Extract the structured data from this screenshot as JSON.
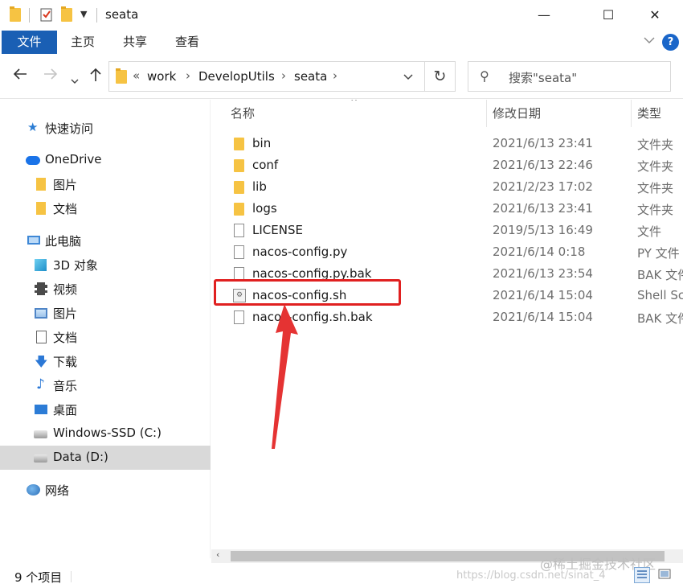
{
  "window": {
    "title": "seata",
    "minimize": "—",
    "maximize": "☐",
    "close": "✕"
  },
  "ribbon": {
    "file_tab": "文件",
    "tabs": [
      "主页",
      "共享",
      "查看"
    ],
    "help": "?"
  },
  "address": {
    "prefix": "«",
    "crumbs": [
      "work",
      "DevelopUtils",
      "seata"
    ],
    "search_placeholder": "搜索\"seata\""
  },
  "sidebar": {
    "items": [
      {
        "label": "快速访问",
        "icon": "star-icon"
      },
      {
        "label": "OneDrive",
        "icon": "cloud-icon"
      },
      {
        "label": "图片",
        "icon": "folder-icon"
      },
      {
        "label": "文档",
        "icon": "folder-icon"
      },
      {
        "label": "此电脑",
        "icon": "pc-icon"
      },
      {
        "label": "3D 对象",
        "icon": "cube-icon"
      },
      {
        "label": "视频",
        "icon": "film-icon"
      },
      {
        "label": "图片",
        "icon": "picture-icon"
      },
      {
        "label": "文档",
        "icon": "document-icon"
      },
      {
        "label": "下载",
        "icon": "download-icon"
      },
      {
        "label": "音乐",
        "icon": "music-icon"
      },
      {
        "label": "桌面",
        "icon": "desktop-icon"
      },
      {
        "label": "Windows-SSD (C:)",
        "icon": "drive-icon"
      },
      {
        "label": "Data (D:)",
        "icon": "drive-icon"
      },
      {
        "label": "网络",
        "icon": "network-icon"
      }
    ]
  },
  "columns": {
    "name": "名称",
    "date": "修改日期",
    "type": "类型"
  },
  "files": [
    {
      "name": "bin",
      "date": "2021/6/13 23:41",
      "type": "文件夹",
      "kind": "folder"
    },
    {
      "name": "conf",
      "date": "2021/6/13 22:46",
      "type": "文件夹",
      "kind": "folder"
    },
    {
      "name": "lib",
      "date": "2021/2/23 17:02",
      "type": "文件夹",
      "kind": "folder"
    },
    {
      "name": "logs",
      "date": "2021/6/13 23:41",
      "type": "文件夹",
      "kind": "folder"
    },
    {
      "name": "LICENSE",
      "date": "2019/5/13 16:49",
      "type": "文件",
      "kind": "file"
    },
    {
      "name": "nacos-config.py",
      "date": "2021/6/14 0:18",
      "type": "PY 文件",
      "kind": "file"
    },
    {
      "name": "nacos-config.py.bak",
      "date": "2021/6/13 23:54",
      "type": "BAK 文件",
      "kind": "file"
    },
    {
      "name": "nacos-config.sh",
      "date": "2021/6/14 15:04",
      "type": "Shell Script",
      "kind": "shell"
    },
    {
      "name": "nacos-config.sh.bak",
      "date": "2021/6/14 15:04",
      "type": "BAK 文件",
      "kind": "file"
    }
  ],
  "status": {
    "item_count": "9 个项目",
    "watermark_url": "https://blog.csdn.net/sinat_4",
    "watermark_site": "@稀土掘金技术社区"
  },
  "colors": {
    "accent": "#1a5fb4",
    "highlight": "#e02020"
  }
}
